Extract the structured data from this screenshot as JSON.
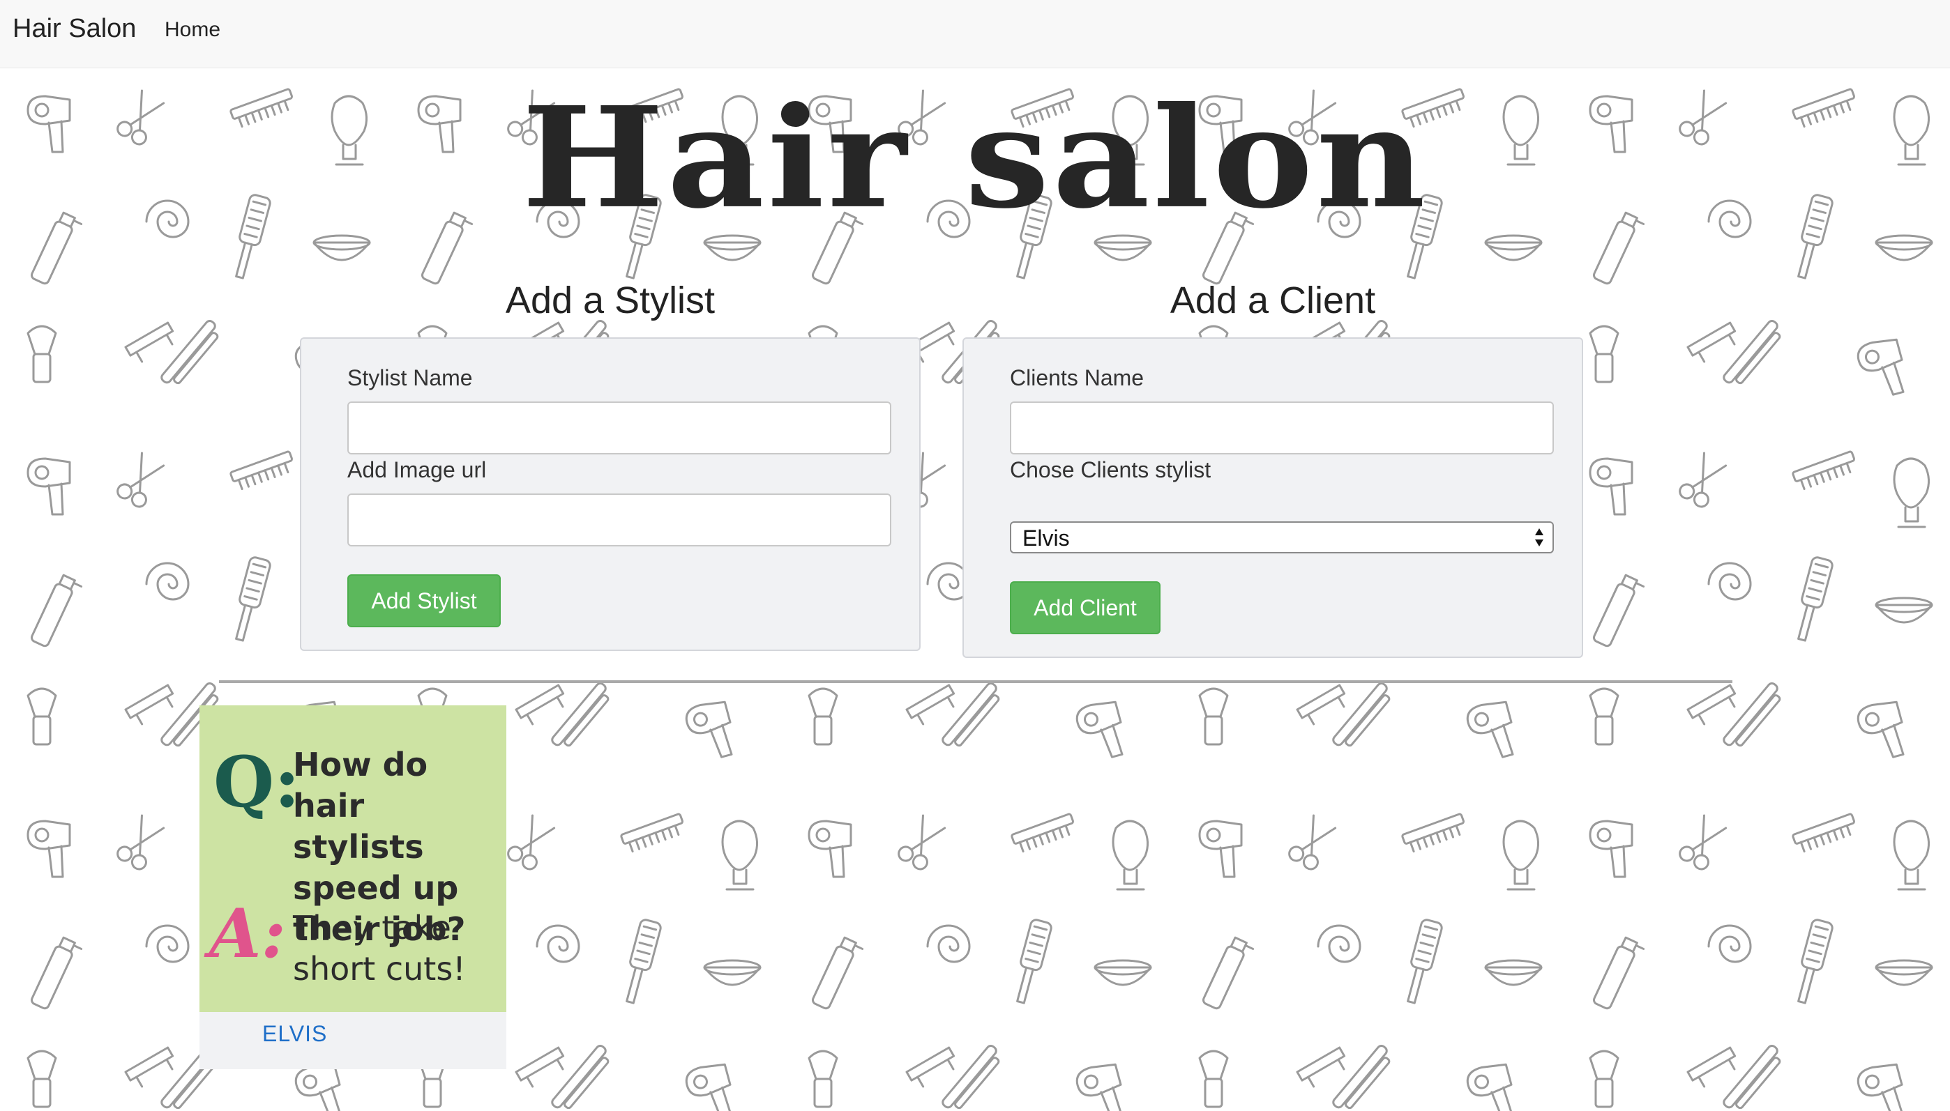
{
  "navbar": {
    "brand": "Hair Salon",
    "home_link": "Home"
  },
  "page": {
    "title": "Hair salon"
  },
  "stylist_form": {
    "heading": "Add a Stylist",
    "name_label": "Stylist Name",
    "name_value": "",
    "image_label": "Add Image url",
    "image_value": "",
    "submit_label": "Add Stylist"
  },
  "client_form": {
    "heading": "Add a Client",
    "name_label": "Clients Name",
    "name_value": "",
    "stylist_label": "Chose Clients stylist",
    "stylist_selected": "Elvis",
    "submit_label": "Add Client"
  },
  "stylists": [
    {
      "name": "ELVIS",
      "image_text": {
        "q_mark": "Q:",
        "question": "How do hair stylists speed up their job?",
        "a_mark": "A:",
        "answer": "They take short cuts!"
      }
    }
  ],
  "colors": {
    "button_green": "#5cb85c",
    "link_blue": "#1f6fc8",
    "card_image_bg": "#cde3a3",
    "q_color": "#1b5b4d",
    "a_color": "#e0548c"
  },
  "icons": [
    "hair-dryer-icon",
    "scissors-icon",
    "comb-icon",
    "brush-icon",
    "spray-bottle-icon",
    "mannequin-head-icon",
    "swirl-icon",
    "bowl-icon"
  ]
}
